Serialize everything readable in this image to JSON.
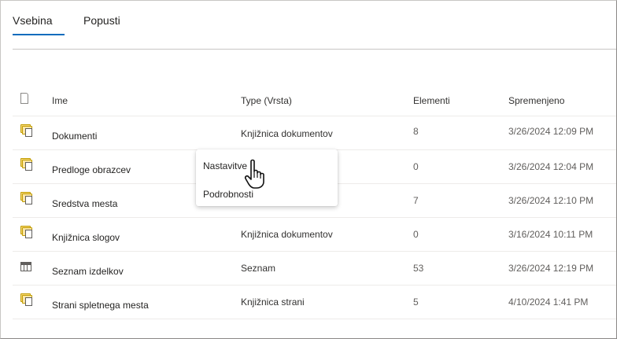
{
  "tabs": [
    {
      "label": "Vsebina",
      "active": true
    },
    {
      "label": "Popusti",
      "active": false
    }
  ],
  "table": {
    "columns": {
      "name": "Ime",
      "type": "Type (Vrsta)",
      "count": "Elementi",
      "modified": "Spremenjeno"
    },
    "rows": [
      {
        "icon": "document-library-icon",
        "name": "Dokumenti",
        "type": "Knjižnica dokumentov",
        "count": "8",
        "modified": "3/26/2024 12:09 PM"
      },
      {
        "icon": "document-library-icon",
        "name": "Predloge obrazcev",
        "type": "",
        "count": "0",
        "modified": "3/26/2024 12:04 PM"
      },
      {
        "icon": "document-library-icon",
        "name": "Sredstva mesta",
        "type": "",
        "count": "7",
        "modified": "3/26/2024 12:10 PM"
      },
      {
        "icon": "document-library-icon",
        "name": "Knjižnica slogov",
        "type": "Knjižnica dokumentov",
        "count": "0",
        "modified": "3/16/2024 10:11 PM"
      },
      {
        "icon": "list-icon",
        "name": "Seznam izdelkov",
        "type": "Seznam",
        "count": "53",
        "modified": "3/26/2024 12:19 PM"
      },
      {
        "icon": "document-library-icon",
        "name": "Strani spletnega mesta",
        "type": "Knjižnica strani",
        "count": "5",
        "modified": "4/10/2024 1:41 PM"
      }
    ]
  },
  "context_menu": {
    "items": [
      "Nastavitve",
      "Podrobnosti"
    ]
  },
  "colors": {
    "accent": "#0f6cbd",
    "folder": "#f7d878"
  }
}
